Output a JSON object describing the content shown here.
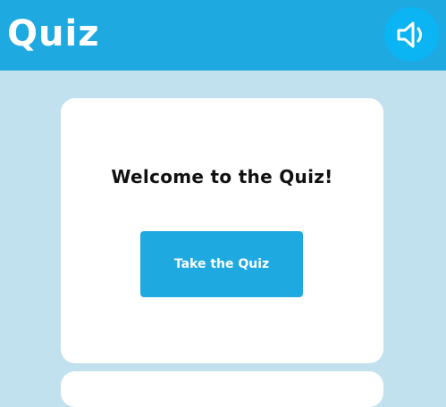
{
  "header": {
    "title": "Quiz",
    "sound_icon": "speaker-volume-icon"
  },
  "card": {
    "welcome_text": "Welcome to the Quiz!",
    "start_button_label": "Take the Quiz"
  },
  "colors": {
    "page_background": "#c2e1ee",
    "header_background": "#1ea9e1",
    "sound_button_background": "#0bb4f3",
    "card_background": "#ffffff",
    "primary_button": "#1ea9e1",
    "button_text": "#ffffff",
    "heading_text": "#111111"
  }
}
